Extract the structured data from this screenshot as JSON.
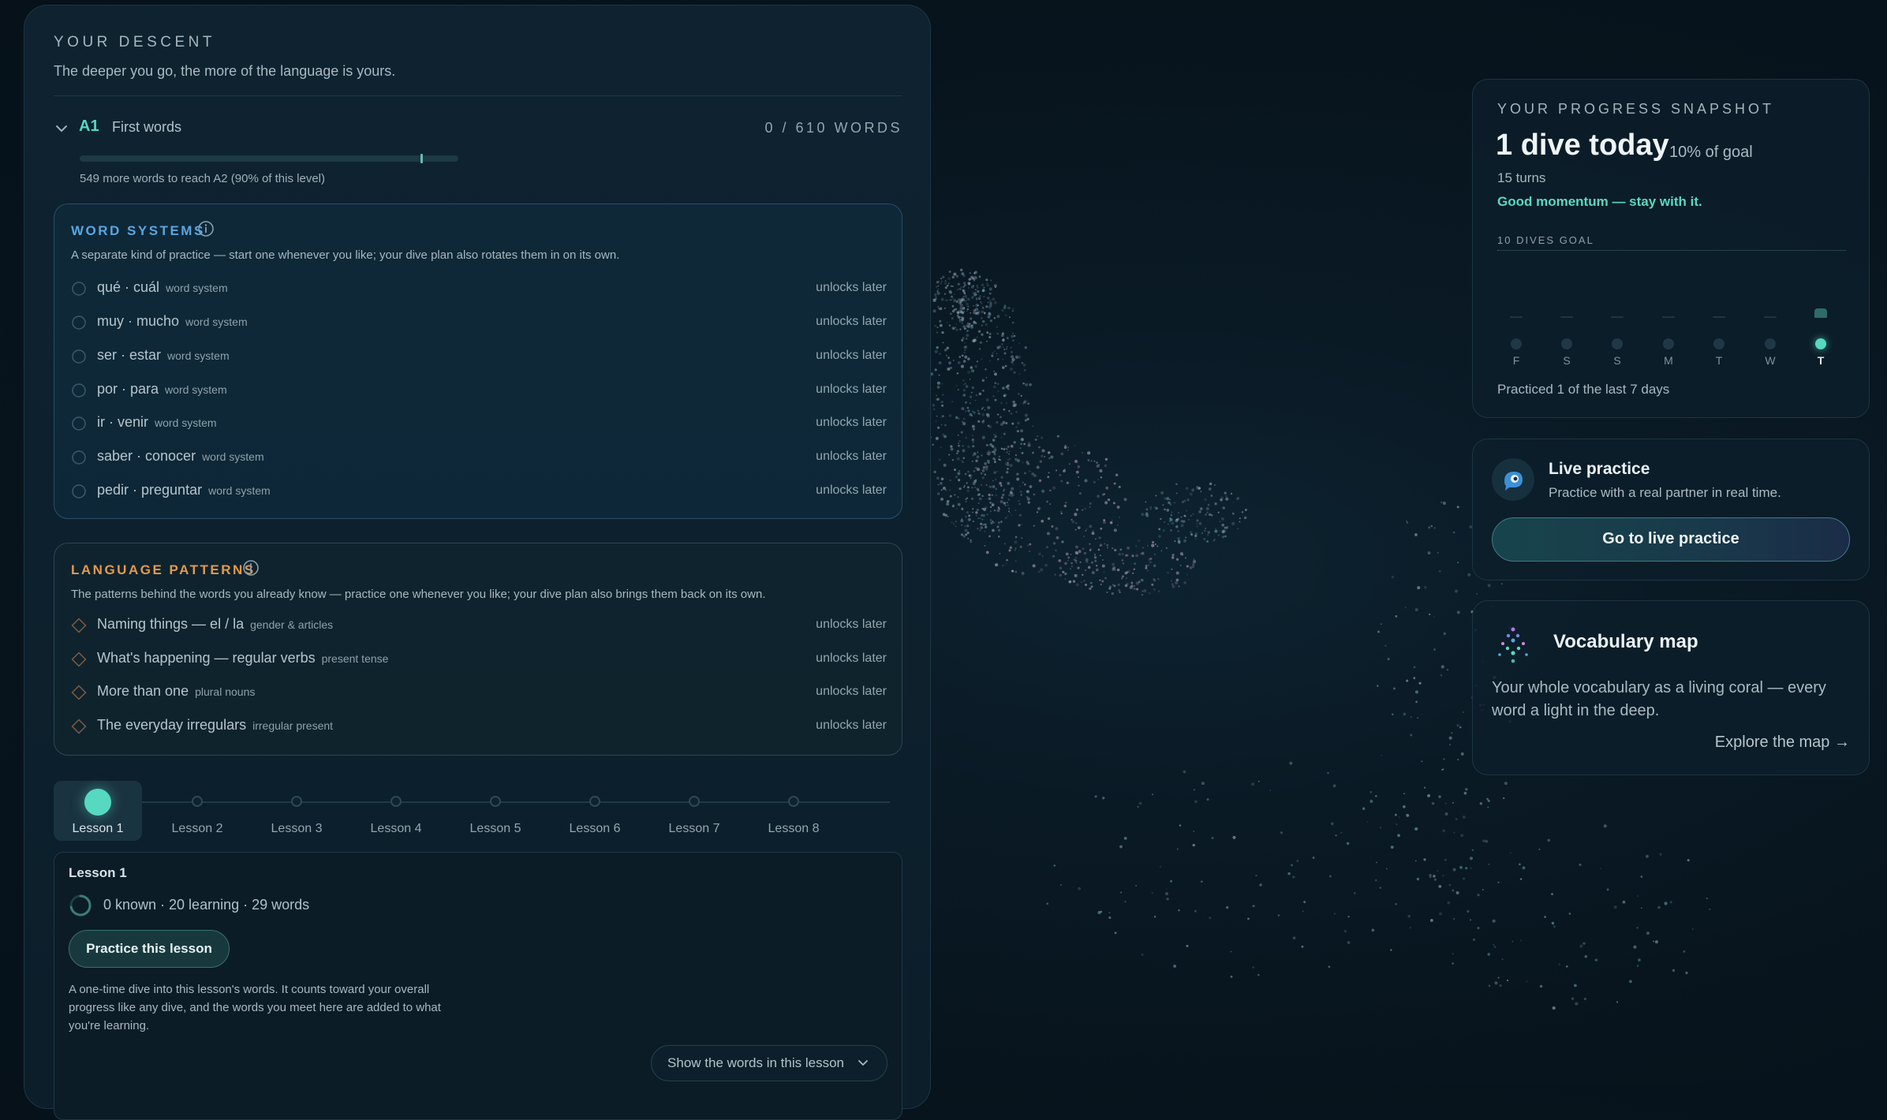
{
  "descent": {
    "title": "YOUR DESCENT",
    "subtitle": "The deeper you go, the more of the language is yours.",
    "level": {
      "code": "A1",
      "name": "First words",
      "count": "0 / 610 WORDS",
      "note": "549 more words to reach A2 (90% of this level)",
      "progress": 0.0,
      "target_marker": 0.9
    }
  },
  "word_systems": {
    "title": "WORD SYSTEMS",
    "description": "A separate kind of practice — start one whenever you like; your dive plan also rotates them in on its own.",
    "items": [
      {
        "label": "qué · cuál",
        "tag": "word system",
        "status": "unlocks later"
      },
      {
        "label": "muy · mucho",
        "tag": "word system",
        "status": "unlocks later"
      },
      {
        "label": "ser · estar",
        "tag": "word system",
        "status": "unlocks later"
      },
      {
        "label": "por · para",
        "tag": "word system",
        "status": "unlocks later"
      },
      {
        "label": "ir · venir",
        "tag": "word system",
        "status": "unlocks later"
      },
      {
        "label": "saber · conocer",
        "tag": "word system",
        "status": "unlocks later"
      },
      {
        "label": "pedir · preguntar",
        "tag": "word system",
        "status": "unlocks later"
      }
    ]
  },
  "language_patterns": {
    "title": "LANGUAGE PATTERNS",
    "description": "The patterns behind the words you already know — practice one whenever you like; your dive plan also brings them back on its own.",
    "items": [
      {
        "label": "Naming things — el / la",
        "tag": "gender & articles",
        "status": "unlocks later"
      },
      {
        "label": "What's happening — regular verbs",
        "tag": "present tense",
        "status": "unlocks later"
      },
      {
        "label": "More than one",
        "tag": "plural nouns",
        "status": "unlocks later"
      },
      {
        "label": "The everyday irregulars",
        "tag": "irregular present",
        "status": "unlocks later"
      }
    ]
  },
  "lessons": {
    "items": [
      "Lesson 1",
      "Lesson 2",
      "Lesson 3",
      "Lesson 4",
      "Lesson 5",
      "Lesson 6",
      "Lesson 7",
      "Lesson 8"
    ],
    "active_index": 0
  },
  "lesson_card": {
    "title": "Lesson 1",
    "stats": "0 known · 20 learning · 29 words",
    "practice_button": "Practice this lesson",
    "description": "A one-time dive into this lesson's words. It counts toward your overall progress like any dive, and the words you meet here are added to what you're learning.",
    "toggle_label": "Show the words in this lesson"
  },
  "snapshot": {
    "label": "YOUR PROGRESS SNAPSHOT",
    "headline": "1 dive today",
    "goal_pct": "10% of goal",
    "turns": "15 turns",
    "momentum": "Good momentum — stay with it.",
    "goal_label": "10 DIVES GOAL",
    "days": [
      {
        "letter": "F",
        "dives": 0,
        "today": false
      },
      {
        "letter": "S",
        "dives": 0,
        "today": false
      },
      {
        "letter": "S",
        "dives": 0,
        "today": false
      },
      {
        "letter": "M",
        "dives": 0,
        "today": false
      },
      {
        "letter": "T",
        "dives": 0,
        "today": false
      },
      {
        "letter": "W",
        "dives": 0,
        "today": false
      },
      {
        "letter": "T",
        "dives": 1,
        "today": true
      }
    ],
    "practiced": "Practiced 1 of the last 7 days"
  },
  "live_practice": {
    "title": "Live practice",
    "subtitle": "Practice with a real partner in real time.",
    "button": "Go to live practice"
  },
  "vocab_map": {
    "title": "Vocabulary map",
    "description": "Your whole vocabulary as a living coral — every word a light in the deep.",
    "link": "Explore the map →"
  },
  "colors": {
    "accent_teal": "#56d9c0",
    "word_systems_blue": "#5aa6e0",
    "patterns_orange": "#e39a4d",
    "background": "#07141d"
  }
}
